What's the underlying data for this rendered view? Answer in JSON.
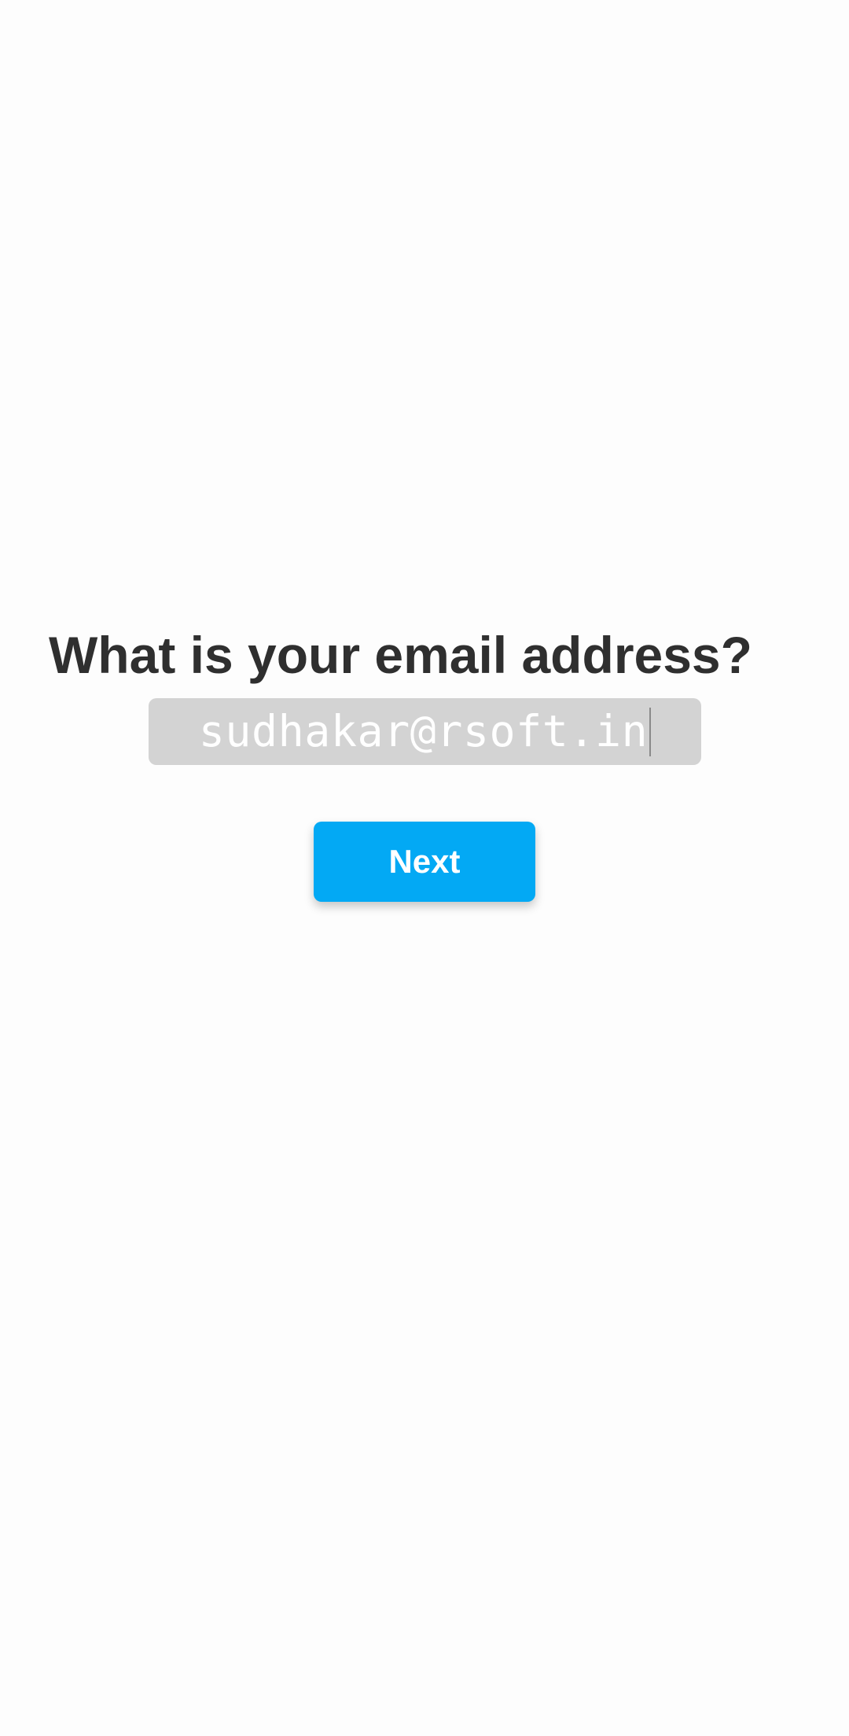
{
  "screen": {
    "question": "What is your email address?",
    "email_input": {
      "value": "sudhakar@rsoft.in",
      "placeholder": ""
    },
    "next_button_label": "Next"
  },
  "colors": {
    "background": "#fdfdfd",
    "heading_text": "#2f2f2f",
    "input_background": "#d3d3d3",
    "input_text": "#ffffff",
    "button_background": "#03a9f4",
    "button_text": "#ffffff"
  }
}
